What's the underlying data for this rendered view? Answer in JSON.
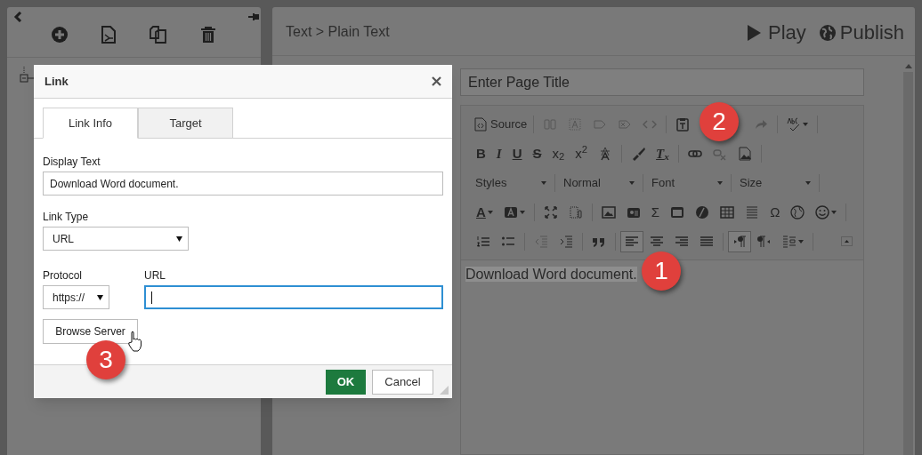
{
  "header": {
    "breadcrumb": "Text > Plain Text",
    "actions": [
      {
        "kind": "play",
        "label": "Play"
      },
      {
        "kind": "publish",
        "label": "Publish"
      }
    ]
  },
  "page_title": {
    "placeholder": "Enter Page Title"
  },
  "editor": {
    "toolbar_rows": [
      [
        {
          "kind": "text-button",
          "label": "Source"
        },
        {
          "kind": "separator"
        },
        {
          "kind": "icon",
          "disabled": true,
          "on": false,
          "menu": false
        },
        {
          "kind": "icon",
          "disabled": true,
          "on": false,
          "menu": false
        },
        {
          "kind": "icon",
          "disabled": true,
          "on": false,
          "menu": false
        },
        {
          "kind": "icon",
          "disabled": true,
          "on": false,
          "menu": false
        },
        {
          "kind": "icon",
          "disabled": true,
          "on": false,
          "menu": false
        },
        {
          "kind": "separator"
        },
        {
          "kind": "icon",
          "disabled": false,
          "on": false,
          "menu": false
        },
        {
          "kind": "icon",
          "disabled": true,
          "on": false,
          "menu": false
        },
        {
          "kind": "separator"
        },
        {
          "kind": "icon",
          "disabled": false,
          "on": false,
          "menu": true
        },
        {
          "kind": "separator"
        }
      ],
      [
        {
          "kind": "glyph",
          "text": "B",
          "disabled": false,
          "on": false,
          "menu": false
        },
        {
          "kind": "glyph",
          "text": "I",
          "disabled": false,
          "on": false,
          "menu": false
        },
        {
          "kind": "glyph",
          "text": "U",
          "disabled": false,
          "on": false,
          "menu": false
        },
        {
          "kind": "glyph",
          "text": "S",
          "disabled": false,
          "on": false,
          "menu": false
        },
        {
          "kind": "glyph",
          "text": "x$_{2}$",
          "disabled": false,
          "on": false,
          "menu": false
        },
        {
          "kind": "glyph",
          "text": "x$^{2}$",
          "disabled": false,
          "on": false,
          "menu": false
        },
        {
          "kind": "icon",
          "disabled": false,
          "on": false,
          "menu": false
        },
        {
          "kind": "separator"
        },
        {
          "kind": "icon",
          "disabled": false,
          "on": false,
          "menu": false
        },
        {
          "kind": "glyph",
          "text": "T$_{x}$",
          "disabled": false,
          "on": false,
          "menu": false
        },
        {
          "kind": "separator"
        },
        {
          "kind": "icon",
          "disabled": false,
          "on": false,
          "menu": false
        },
        {
          "kind": "icon",
          "disabled": true,
          "on": false,
          "menu": false
        },
        {
          "kind": "icon",
          "disabled": false,
          "on": false,
          "menu": false
        },
        {
          "kind": "separator"
        }
      ],
      [
        {
          "kind": "dropdown",
          "label": "Styles"
        },
        {
          "kind": "separator"
        },
        {
          "kind": "dropdown",
          "label": "Normal"
        },
        {
          "kind": "separator"
        },
        {
          "kind": "dropdown",
          "label": "Font"
        },
        {
          "kind": "separator"
        },
        {
          "kind": "dropdown",
          "label": "Size"
        },
        {
          "kind": "separator"
        }
      ],
      [
        {
          "kind": "glyph",
          "text": "A",
          "disabled": false,
          "on": false,
          "menu": true
        },
        {
          "kind": "icon",
          "disabled": false,
          "on": false,
          "menu": true
        },
        {
          "kind": "separator"
        },
        {
          "kind": "icon",
          "disabled": false,
          "on": false,
          "menu": false
        },
        {
          "kind": "icon",
          "disabled": false,
          "on": false,
          "menu": false
        },
        {
          "kind": "separator"
        },
        {
          "kind": "icon",
          "disabled": false,
          "on": false,
          "menu": false
        },
        {
          "kind": "icon",
          "disabled": false,
          "on": false,
          "menu": false
        },
        {
          "kind": "glyph",
          "text": "Σ",
          "disabled": false,
          "on": false,
          "menu": false
        },
        {
          "kind": "icon",
          "disabled": false,
          "on": false,
          "menu": false
        },
        {
          "kind": "icon",
          "disabled": false,
          "on": false,
          "menu": false
        },
        {
          "kind": "icon",
          "disabled": false,
          "on": false,
          "menu": false
        },
        {
          "kind": "icon",
          "disabled": false,
          "on": false,
          "menu": false
        },
        {
          "kind": "glyph",
          "text": "Ω",
          "disabled": false,
          "on": false,
          "menu": false
        },
        {
          "kind": "icon",
          "disabled": false,
          "on": false,
          "menu": false
        },
        {
          "kind": "icon",
          "disabled": false,
          "on": false,
          "menu": true
        },
        {
          "kind": "separator"
        }
      ],
      [
        {
          "kind": "icon",
          "disabled": false,
          "on": false,
          "menu": false
        },
        {
          "kind": "icon",
          "disabled": false,
          "on": false,
          "menu": false
        },
        {
          "kind": "separator"
        },
        {
          "kind": "icon",
          "disabled": true,
          "on": false,
          "menu": false
        },
        {
          "kind": "icon",
          "disabled": false,
          "on": false,
          "menu": false
        },
        {
          "kind": "separator"
        },
        {
          "kind": "icon",
          "disabled": false,
          "on": false,
          "menu": false
        },
        {
          "kind": "separator"
        },
        {
          "kind": "icon",
          "disabled": false,
          "on": true,
          "menu": false
        },
        {
          "kind": "icon",
          "disabled": false,
          "on": false,
          "menu": false
        },
        {
          "kind": "icon",
          "disabled": false,
          "on": false,
          "menu": false
        },
        {
          "kind": "icon",
          "disabled": false,
          "on": false,
          "menu": false
        },
        {
          "kind": "separator"
        },
        {
          "kind": "icon",
          "disabled": false,
          "on": true,
          "menu": false
        },
        {
          "kind": "icon",
          "disabled": false,
          "on": false,
          "menu": false
        },
        {
          "kind": "icon",
          "disabled": false,
          "on": false,
          "menu": true
        },
        {
          "kind": "separator"
        }
      ]
    ],
    "content": "Download Word document.",
    "content_selected": true
  },
  "dialog": {
    "title": "Link",
    "tabs": [
      {
        "label": "Link Info",
        "selected": true
      },
      {
        "label": "Target",
        "selected": false
      }
    ],
    "display_text": {
      "label": "Display Text",
      "value": "Download Word document."
    },
    "link_type": {
      "label": "Link Type",
      "value": "URL"
    },
    "protocol": {
      "label": "Protocol",
      "value": "https://"
    },
    "url": {
      "label": "URL",
      "focused": true
    },
    "browse_button": "Browse Server",
    "buttons": [
      {
        "kind": "primary",
        "label": "OK"
      },
      {
        "kind": "secondary",
        "label": "Cancel"
      }
    ]
  },
  "callouts": [
    "1",
    "2",
    "3"
  ]
}
